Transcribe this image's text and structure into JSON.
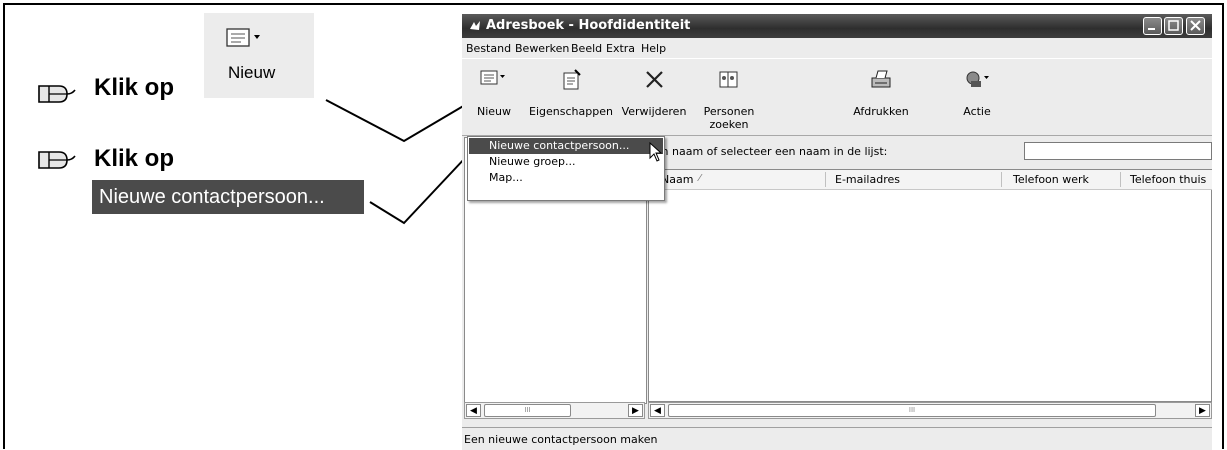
{
  "instructions": {
    "step1_text": "Klik op",
    "step1_button_label": "Nieuw",
    "step2_text": "Klik op",
    "step2_menu_label": "Nieuwe contactpersoon..."
  },
  "window": {
    "title": "Adresboek - Hoofdidentiteit",
    "menu": [
      "Bestand",
      "Bewerken",
      "Beeld",
      "Extra",
      "Help"
    ],
    "toolbar": [
      {
        "label": "Nieuw",
        "icon": "new-card-icon"
      },
      {
        "label": "Eigenschappen",
        "icon": "properties-icon"
      },
      {
        "label": "Verwijderen",
        "icon": "delete-icon"
      },
      {
        "label": "Personen zoeken",
        "icon": "find-people-icon"
      },
      {
        "label": "Afdrukken",
        "icon": "printer-icon"
      },
      {
        "label": "Actie",
        "icon": "action-icon"
      }
    ],
    "search_label": "een naam of selecteer een naam in de lijst:",
    "search_value": "",
    "columns": [
      "Naam",
      "E-mailadres",
      "Telefoon werk",
      "Telefoon thuis"
    ],
    "dropdown": [
      "Nieuwe contactpersoon...",
      "Nieuwe groep...",
      "Map..."
    ],
    "status": "Een nieuwe contactpersoon maken"
  }
}
